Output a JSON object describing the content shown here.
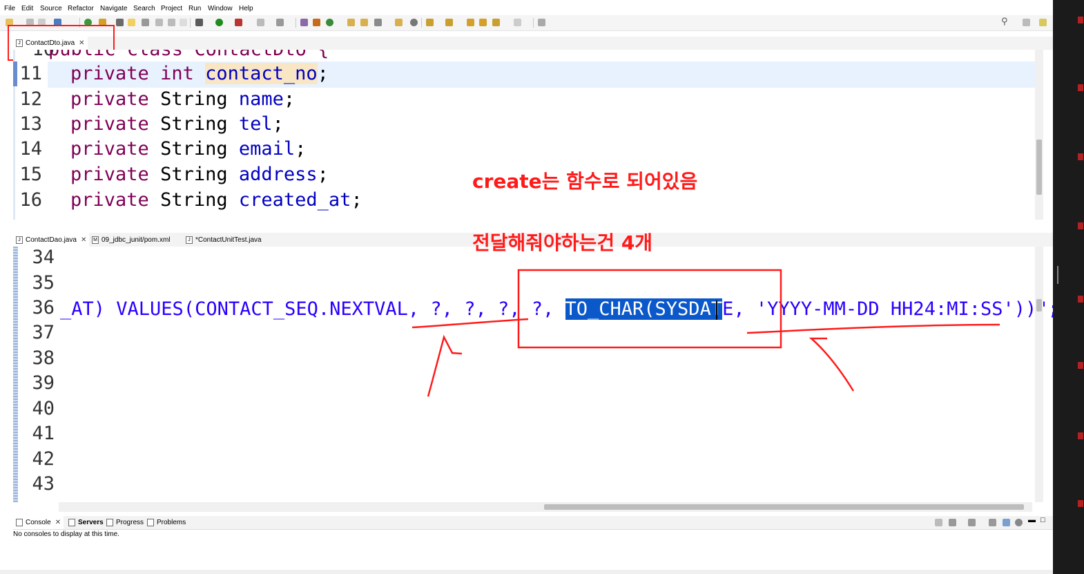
{
  "menu": [
    "File",
    "Edit",
    "Source",
    "Refactor",
    "Navigate",
    "Search",
    "Project",
    "Run",
    "Window",
    "Help"
  ],
  "top_editor": {
    "tab": "ContactDto.java",
    "lines": [
      {
        "no": "10",
        "text": "public class ContactDto {"
      },
      {
        "no": "11",
        "kw": "private",
        "type": "int",
        "field": "contact_no",
        "end": ";"
      },
      {
        "no": "12",
        "kw": "private",
        "type": "String",
        "field": "name",
        "end": ";"
      },
      {
        "no": "13",
        "kw": "private",
        "type": "String",
        "field": "tel",
        "end": ";"
      },
      {
        "no": "14",
        "kw": "private",
        "type": "String",
        "field": "email",
        "end": ";"
      },
      {
        "no": "15",
        "kw": "private",
        "type": "String",
        "field": "address",
        "end": ";"
      },
      {
        "no": "16",
        "kw": "private",
        "type": "String",
        "field": "created_at",
        "end": ";"
      }
    ]
  },
  "bottom_editor": {
    "tabs": [
      "ContactDao.java",
      "09_jdbc_junit/pom.xml",
      "*ContactUnitTest.java"
    ],
    "line_numbers": [
      "34",
      "35",
      "36",
      "37",
      "38",
      "39",
      "40",
      "41",
      "42",
      "43"
    ],
    "line36": {
      "prefix": "_AT) VALUES(CONTACT_SEQ.NEXTVAL, ?, ?, ?, ?, ",
      "selected": "TO_CHAR(SYSDAT",
      "cursor_char": "E",
      "after": ", ",
      "string": "'YYYY-MM-DD HH24:MI:SS'",
      "tail": "))\";"
    }
  },
  "annotations": {
    "note1": "create는 함수로 되어있음",
    "note2": "전달해줘야하는건 4개"
  },
  "console": {
    "tabs": [
      "Console",
      "Servers",
      "Progress",
      "Problems"
    ],
    "message": "No consoles to display at this time."
  },
  "colors": {
    "annotation": "#ff1a1a",
    "keyword": "#7f0055",
    "field": "#0000c0",
    "selection": "#0a58c9"
  }
}
